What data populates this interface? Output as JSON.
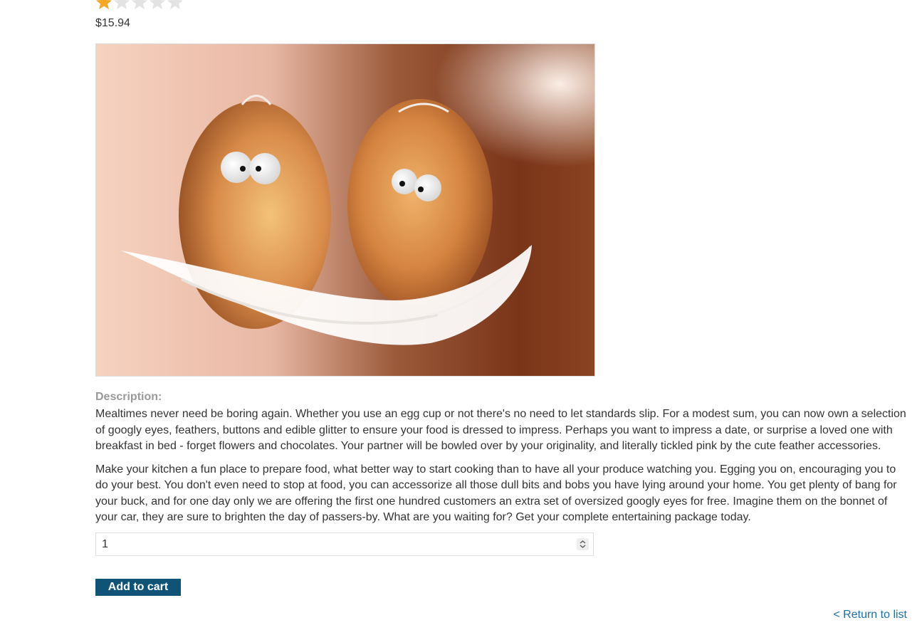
{
  "product": {
    "rating": {
      "value": 1,
      "max": 5
    },
    "price": "$15.94",
    "image_alt": "Two brown eggs with googly eyes on a white feather"
  },
  "description": {
    "label": "Description:",
    "paragraphs": [
      "Mealtimes never need be boring again. Whether you use an egg cup or not there's no need to let standards slip. For a modest sum, you can now own a selection of googly eyes, feathers, buttons and edible glitter to ensure your food is dressed to impress. Perhaps you want to impress a date, or surprise a loved one with breakfast in bed - forget flowers and chocolates. Your partner will be bowled over by your originality, and literally tickled pink by the cute feather accessories.",
      "Make your kitchen a fun place to prepare food, what better way to start cooking than to have all your produce watching you. Egging you on, encouraging you to do your best. You don't even need to stop at food, you can accessorize all those dull bits and bobs you have lying around your home. You get plenty of bang for your buck, and for one day only we are offering the first one hundred customers an extra set of oversized googly eyes for free. Imagine them on the bonnet of your car, they are sure to brighten the day of passers-by. What are you waiting for? Get your complete entertaining package today."
    ]
  },
  "cart": {
    "quantity": "1",
    "add_label": "Add to cart"
  },
  "nav": {
    "return_label": "< Return to list"
  },
  "colors": {
    "button_bg": "#0f5476",
    "link": "#1a6fa8",
    "star_filled": "#f5a623",
    "star_empty": "#e0e0e0"
  },
  "icons": {
    "star_filled": "star-filled-icon",
    "star_empty": "star-empty-icon",
    "spinner": "number-spinner-icon"
  }
}
